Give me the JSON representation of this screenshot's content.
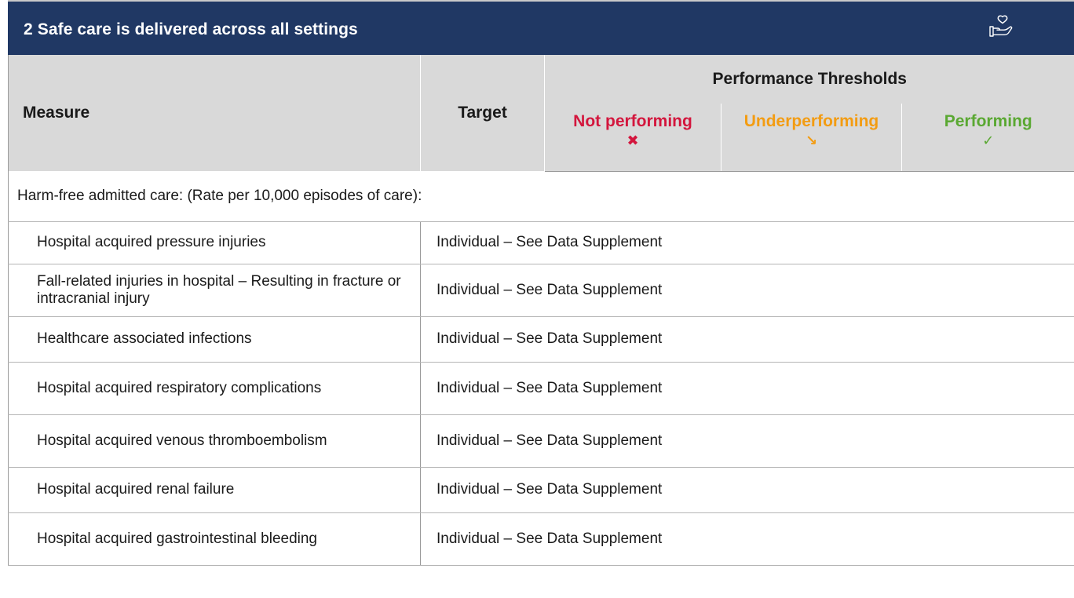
{
  "section": {
    "title": "2 Safe care is delivered across all settings",
    "icon": "heart-in-hand-icon"
  },
  "header": {
    "measure": "Measure",
    "target": "Target",
    "thresholds": "Performance Thresholds",
    "not_performing": "Not performing",
    "not_performing_symbol": "✖",
    "underperforming": "Underperforming",
    "underperforming_symbol": "↘",
    "performing": "Performing",
    "performing_symbol": "✓"
  },
  "colors": {
    "title_bg": "#203864",
    "not_performing": "#d3163d",
    "underperforming": "#f39c12",
    "performing": "#5aa832"
  },
  "group_label": "Harm-free admitted care: (Rate per 10,000 episodes of care):",
  "rows": [
    {
      "measure": "Hospital acquired pressure injuries",
      "target": "Individual – See Data Supplement"
    },
    {
      "measure": "Fall-related injuries in hospital – Resulting in fracture or intracranial injury",
      "target": "Individual – See Data Supplement"
    },
    {
      "measure": "Healthcare associated infections",
      "target": "Individual – See Data Supplement"
    },
    {
      "measure": "Hospital acquired respiratory complications",
      "target": "Individual – See Data Supplement"
    },
    {
      "measure": "Hospital acquired venous thromboembolism",
      "target": "Individual – See Data Supplement"
    },
    {
      "measure": "Hospital acquired renal failure",
      "target": "Individual – See Data Supplement"
    },
    {
      "measure": "Hospital acquired gastrointestinal bleeding",
      "target": "Individual – See Data Supplement"
    }
  ]
}
